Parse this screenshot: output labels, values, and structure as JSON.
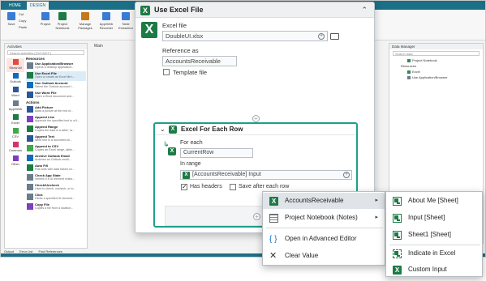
{
  "ribbon": {
    "tabs": [
      "HOME",
      "DESIGN"
    ],
    "buttons": [
      "Save",
      "Cut",
      "Copy",
      "Paste",
      "Project",
      "Project Notebook",
      "Manage Packages",
      "Add Web Recorder",
      "App/Web Recorder",
      "Table Extraction"
    ]
  },
  "doc_tab": "Main",
  "activities": {
    "title": "Activities",
    "search_placeholder": "Search activities (Ctrl+Alt+F)",
    "categories": [
      "Show All",
      "Outlook",
      "Word",
      "App/Web",
      "Excel",
      "CSV",
      "Common",
      "Other"
    ],
    "resources_header": "Resources",
    "resources": [
      {
        "title": "Use Application/Browser",
        "desc": "Opens a desktop application..."
      },
      {
        "title": "Use Excel File",
        "desc": "Open or create an Excel file t..."
      },
      {
        "title": "Use Outlook Account",
        "desc": "Select the Outlook account t..."
      },
      {
        "title": "Use Word File",
        "desc": "Open a Word document and..."
      }
    ],
    "actions_header": "Actions",
    "actions": [
      {
        "title": "Add Picture",
        "desc": "Adds a picture at the end of..."
      },
      {
        "title": "Append Line",
        "desc": "Appends the specified text to a fi..."
      },
      {
        "title": "Append Range",
        "desc": "Copies the data in a table, ra..."
      },
      {
        "title": "Append Text",
        "desc": "Write text in a document at..."
      },
      {
        "title": "Append to CSV",
        "desc": "Copies an Excel range, table..."
      },
      {
        "title": "Archive Outlook Email",
        "desc": "Archives an Outlook email..."
      },
      {
        "title": "Auto Fill",
        "desc": "Fills cells with data based on..."
      },
      {
        "title": "Check App State",
        "desc": "Verifies if a UI element exists..."
      },
      {
        "title": "Check/Uncheck",
        "desc": "Used to check, uncheck, or to..."
      },
      {
        "title": "Click",
        "desc": "Clicks a specified UI element..."
      },
      {
        "title": "Copy File",
        "desc": "Copies a file from a location..."
      }
    ]
  },
  "bottom_tabs": [
    "Output",
    "Error List",
    "Find References"
  ],
  "data_manager": {
    "title": "Data Manager",
    "search_placeholder": "Search data",
    "nodes": [
      "Project Notebook",
      "Resources",
      "Excel",
      "Use Application/Browser"
    ]
  },
  "use_excel": {
    "title": "Use Excel File",
    "excel_file_label": "Excel file",
    "excel_file_value": "DoubleUI.xlsx",
    "reference_label": "Reference as",
    "reference_value": "AccountsReceivable",
    "template_label": "Template file",
    "connector": "+"
  },
  "for_each": {
    "title": "Excel For Each Row",
    "for_each_label": "For each",
    "for_each_value": "CurrentRow",
    "in_range_label": "In range",
    "in_range_value": "[AccountsReceivable] Input",
    "has_headers_label": "Has headers",
    "has_headers_checked": true,
    "save_after_label": "Save after each row",
    "save_after_checked": false
  },
  "context_menu": {
    "items": [
      {
        "label": "AccountsReceivable",
        "icon": "excel-icon",
        "submenu": true,
        "highlighted": true
      },
      {
        "label": "Project Notebook (Notes)",
        "icon": "notebook-icon",
        "submenu": true,
        "highlighted": false
      },
      {
        "label": "Open in Advanced Editor",
        "icon": "braces-icon",
        "submenu": false,
        "highlighted": false
      },
      {
        "label": "Clear Value",
        "icon": "close-icon",
        "submenu": false,
        "highlighted": false
      }
    ]
  },
  "submenu": {
    "items": [
      {
        "label": "About Me [Sheet]",
        "icon": "sheet-icon"
      },
      {
        "label": "Input [Sheet]",
        "icon": "sheet-icon"
      },
      {
        "label": "Sheet1 [Sheet]",
        "icon": "sheet-icon"
      },
      {
        "label": "Indicate in Excel",
        "icon": "indicate-excel-icon"
      },
      {
        "label": "Custom Input",
        "icon": "excel-icon"
      }
    ]
  },
  "colors": {
    "brand": "#1b6f86",
    "excel_green": "#1d7b45",
    "foreach_border": "#1f9e8a",
    "menu_highlight": "#dfe4e8"
  }
}
